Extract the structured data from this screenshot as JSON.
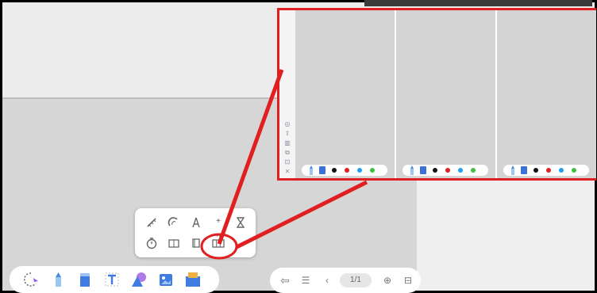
{
  "toolbar": {
    "items": [
      "lasso-tool",
      "pen-tool",
      "highlighter-tool",
      "text-tool",
      "shape-tool",
      "image-tool",
      "more-tools"
    ]
  },
  "popup": {
    "tools": [
      "ruler-icon",
      "protractor-icon",
      "compass-icon",
      "calculator-icon",
      "hourglass-icon",
      "timer-icon",
      "scoreboard-icon",
      "book-icon",
      "split-screen-icon"
    ]
  },
  "nav": {
    "page": "1/1"
  },
  "zoom_panel": {
    "sidebar_icons": [
      "target-icon",
      "share-icon",
      "trash-icon",
      "copy-icon",
      "export-icon",
      "close-icon"
    ],
    "panel_count": 3,
    "pen_colors": [
      "#111111",
      "#e02020",
      "#20a0f0",
      "#40c040"
    ]
  },
  "annotation": {
    "color": "#e02020"
  }
}
